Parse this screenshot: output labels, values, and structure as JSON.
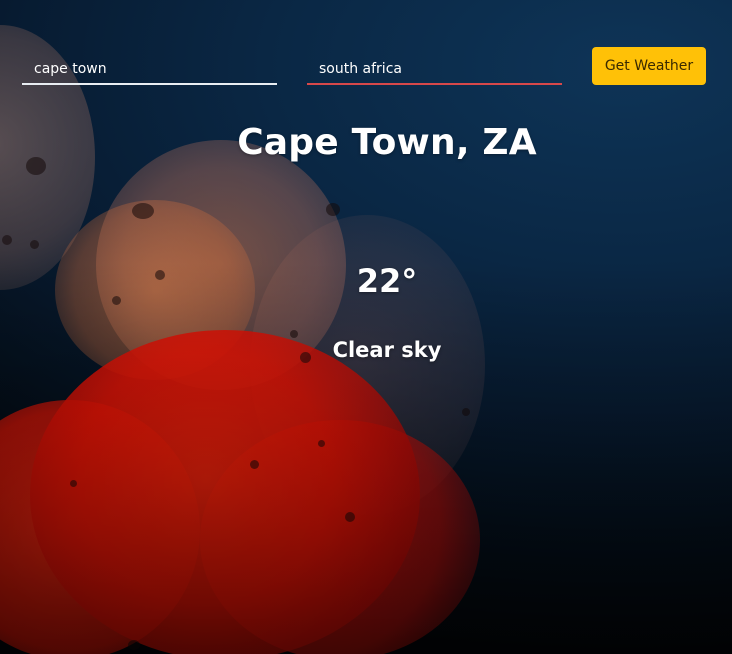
{
  "form": {
    "city_value": "cape town",
    "country_value": "south africa",
    "submit_label": "Get Weather",
    "accent_color": "#ffc107",
    "country_underline_color": "#d8484a"
  },
  "weather": {
    "location": "Cape Town, ZA",
    "temperature": "22",
    "unit_symbol": "°",
    "description": "Clear sky"
  }
}
